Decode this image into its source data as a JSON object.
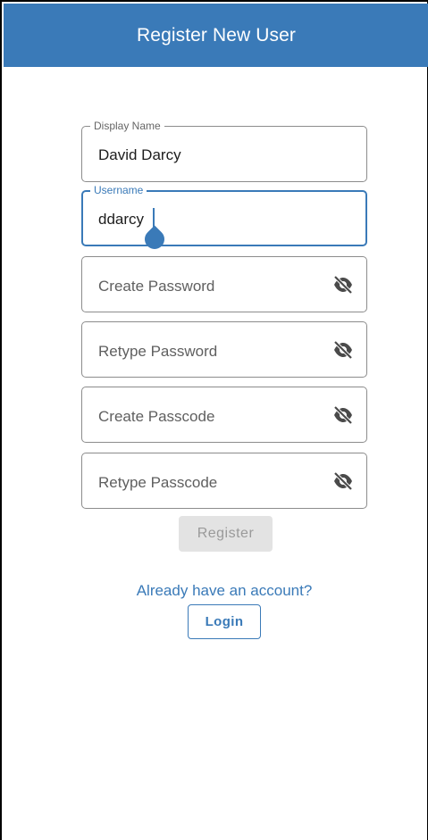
{
  "header": {
    "title": "Register New User"
  },
  "form": {
    "display_name": {
      "label": "Display Name",
      "value": "David Darcy"
    },
    "username": {
      "label": "Username",
      "value": "ddarcy"
    },
    "create_password": {
      "placeholder": "Create Password",
      "icon": "eye-off-icon"
    },
    "retype_password": {
      "placeholder": "Retype Password",
      "icon": "eye-off-icon"
    },
    "create_passcode": {
      "placeholder": "Create Passcode",
      "icon": "eye-off-icon"
    },
    "retype_passcode": {
      "placeholder": "Retype Passcode",
      "icon": "eye-off-icon"
    },
    "register_label": "Register"
  },
  "footer": {
    "account_prompt": "Already have an account?",
    "login_label": "Login"
  },
  "colors": {
    "primary": "#3a7ab8",
    "disabled_bg": "#e3e3e3",
    "disabled_text": "#9a9a9a",
    "outline": "#8c8c8c"
  }
}
